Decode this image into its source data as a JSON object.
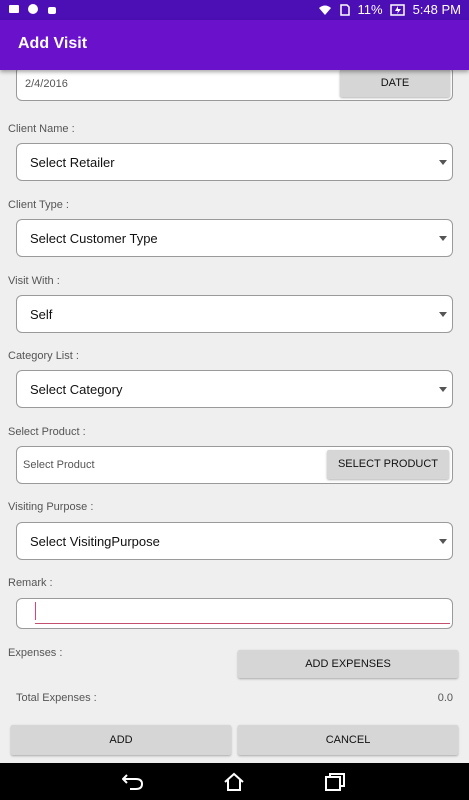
{
  "status": {
    "battery_pct": "11%",
    "time": "5:48 PM"
  },
  "appbar": {
    "title": "Add Visit"
  },
  "date": {
    "value": "2/4/2016",
    "button": "DATE"
  },
  "client_name": {
    "label": "Client Name :",
    "value": "Select Retailer"
  },
  "client_type": {
    "label": "Client Type :",
    "value": "Select Customer Type"
  },
  "visit_with": {
    "label": "Visit With :",
    "value": "Self"
  },
  "category": {
    "label": "Category List :",
    "value": "Select Category"
  },
  "product": {
    "label": "Select Product :",
    "placeholder": "Select Product",
    "button": "SELECT PRODUCT"
  },
  "purpose": {
    "label": "Visiting Purpose :",
    "value": "Select VisitingPurpose"
  },
  "remark": {
    "label": "Remark :",
    "value": ""
  },
  "expenses": {
    "label": "Expenses :",
    "button": "ADD EXPENSES",
    "total_label": "Total Expenses :",
    "total_value": "0.0"
  },
  "actions": {
    "add": "ADD",
    "cancel": "CANCEL"
  },
  "colors": {
    "primary": "#6a11cb",
    "status_bar": "#4b0fb5",
    "cursor": "#e0407a"
  },
  "icons": [
    "usb-icon",
    "face-icon",
    "android-icon",
    "wifi-icon",
    "sim-icon",
    "battery-charging-icon",
    "back-icon",
    "home-icon",
    "recents-icon"
  ]
}
